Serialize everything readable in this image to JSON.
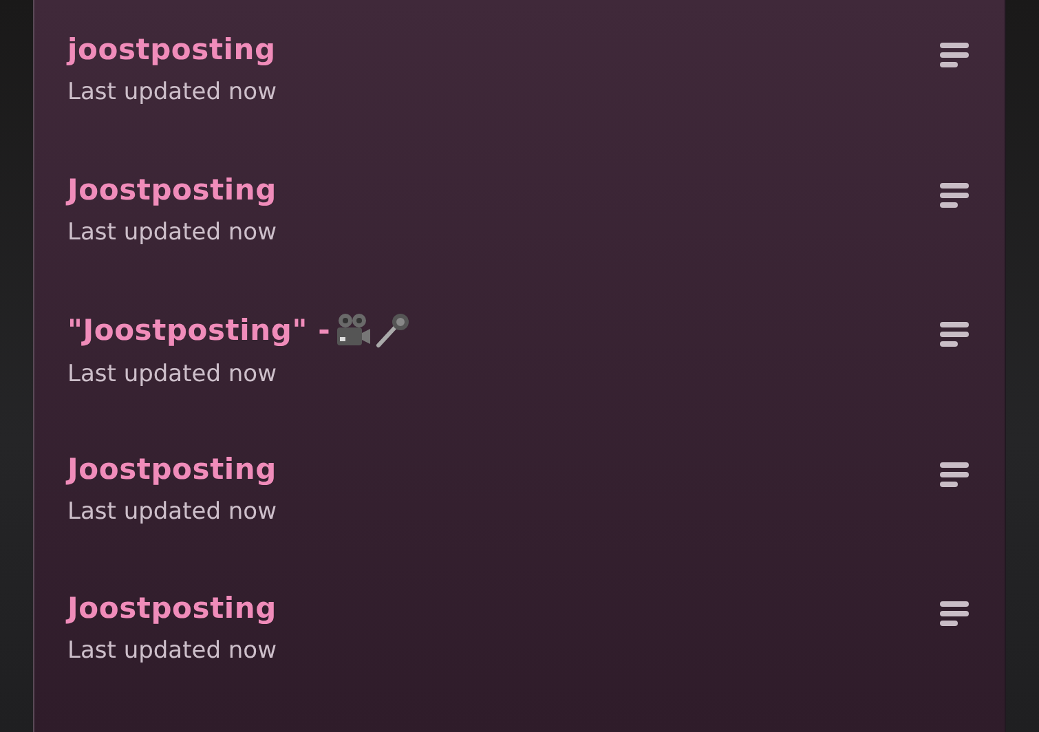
{
  "documents": [
    {
      "kind": "plain",
      "title": "joostposting",
      "subtitle": "Last updated now"
    },
    {
      "kind": "plain",
      "title": "Joostposting",
      "subtitle": "Last updated now"
    },
    {
      "kind": "with-emoji",
      "title": "\"Joostposting\" -",
      "subtitle": "Last updated now"
    },
    {
      "kind": "plain",
      "title": "Joostposting",
      "subtitle": "Last updated now"
    },
    {
      "kind": "plain",
      "title": "Joostposting",
      "subtitle": "Last updated now"
    }
  ]
}
